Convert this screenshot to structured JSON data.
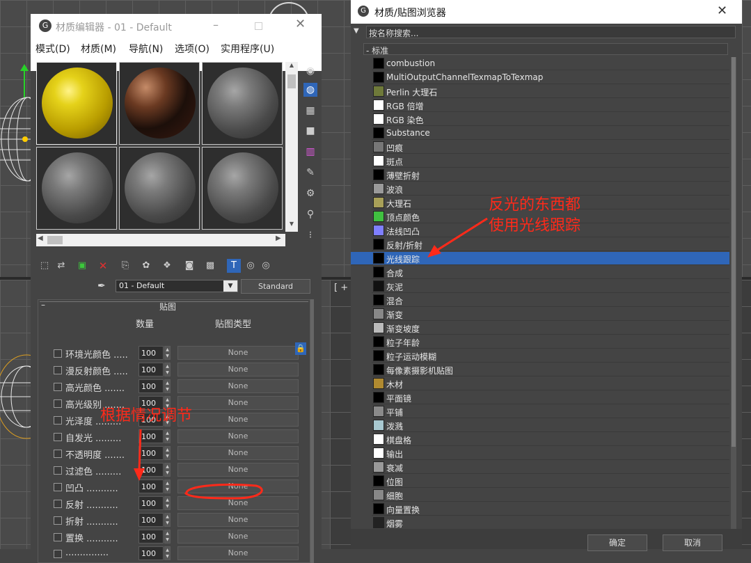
{
  "material_editor": {
    "title": "材质编辑器 - 01 - Default",
    "menu": [
      "模式(D)",
      "材质(M)",
      "导航(N)",
      "选项(O)",
      "实用程序(U)"
    ],
    "material_name": "01 - Default",
    "material_type": "Standard",
    "rollout_title": "贴图",
    "columns": {
      "amount": "数量",
      "map_type": "贴图类型"
    },
    "rows": [
      {
        "label": "环境光颜色 .....",
        "amount": "100",
        "map": "None"
      },
      {
        "label": "漫反射颜色 .....",
        "amount": "100",
        "map": "None"
      },
      {
        "label": "高光颜色 .......",
        "amount": "100",
        "map": "None"
      },
      {
        "label": "高光级别 .......",
        "amount": "100",
        "map": "None"
      },
      {
        "label": "光泽度 .........",
        "amount": "100",
        "map": "None"
      },
      {
        "label": "自发光 .........",
        "amount": "100",
        "map": "None"
      },
      {
        "label": "不透明度 .......",
        "amount": "100",
        "map": "None"
      },
      {
        "label": "过滤色 .........",
        "amount": "100",
        "map": "None"
      },
      {
        "label": "凹凸 ...........",
        "amount": "100",
        "map": "None"
      },
      {
        "label": "反射 ...........",
        "amount": "100",
        "map": "None"
      },
      {
        "label": "折射 ...........",
        "amount": "100",
        "map": "None"
      },
      {
        "label": "置换 ...........",
        "amount": "100",
        "map": "None"
      },
      {
        "label": "...............",
        "amount": "100",
        "map": "None"
      }
    ]
  },
  "browser": {
    "title": "材质/贴图浏览器",
    "search_placeholder": "按名称搜索...",
    "group_label": "- 标准",
    "items": [
      {
        "name": "combustion",
        "swatch": "#000000"
      },
      {
        "name": "MultiOutputChannelTexmapToTexmap",
        "swatch": "#000000"
      },
      {
        "name": "Perlin 大理石",
        "swatch": "#6f7a3a"
      },
      {
        "name": "RGB 倍增",
        "swatch": "#ffffff"
      },
      {
        "name": "RGB 染色",
        "swatch": "#ffffff"
      },
      {
        "name": "Substance",
        "swatch": "#000000"
      },
      {
        "name": "凹痕",
        "swatch": "#777777"
      },
      {
        "name": "斑点",
        "swatch": "#ffffff"
      },
      {
        "name": "薄壁折射",
        "swatch": "#000000"
      },
      {
        "name": "波浪",
        "swatch": "#9a9a9a"
      },
      {
        "name": "大理石",
        "swatch": "#a8a058"
      },
      {
        "name": "顶点颜色",
        "swatch": "#40c040"
      },
      {
        "name": "法线凹凸",
        "swatch": "#7f7fff"
      },
      {
        "name": "反射/折射",
        "swatch": "#000000"
      },
      {
        "name": "光线跟踪",
        "swatch": "#000000"
      },
      {
        "name": "合成",
        "swatch": "#000000"
      },
      {
        "name": "灰泥",
        "swatch": "#111111"
      },
      {
        "name": "混合",
        "swatch": "#000000"
      },
      {
        "name": "渐变",
        "swatch": "#888888"
      },
      {
        "name": "渐变坡度",
        "swatch": "#bbbbbb"
      },
      {
        "name": "粒子年龄",
        "swatch": "#000000"
      },
      {
        "name": "粒子运动模糊",
        "swatch": "#000000"
      },
      {
        "name": "每像素摄影机贴图",
        "swatch": "#000000"
      },
      {
        "name": "木材",
        "swatch": "#b08a30"
      },
      {
        "name": "平面镜",
        "swatch": "#000000"
      },
      {
        "name": "平铺",
        "swatch": "#8a8a8a"
      },
      {
        "name": "泼溅",
        "swatch": "#a8c8d0"
      },
      {
        "name": "棋盘格",
        "swatch": "#ffffff"
      },
      {
        "name": "输出",
        "swatch": "#ffffff"
      },
      {
        "name": "衰减",
        "swatch": "#999999"
      },
      {
        "name": "位图",
        "swatch": "#000000"
      },
      {
        "name": "细胞",
        "swatch": "#888888"
      },
      {
        "name": "向量置换",
        "swatch": "#000000"
      },
      {
        "name": "烟雾",
        "swatch": "#222222"
      }
    ],
    "selected_index": 14,
    "ok_label": "确定",
    "cancel_label": "取消"
  },
  "annotations": {
    "reflect_note": "反光的东西都\n使用光线跟踪",
    "adjust_note": "根据情况调节"
  },
  "colors": {
    "annotation_red": "#ff2a1a",
    "selection": "#2f66b8"
  }
}
